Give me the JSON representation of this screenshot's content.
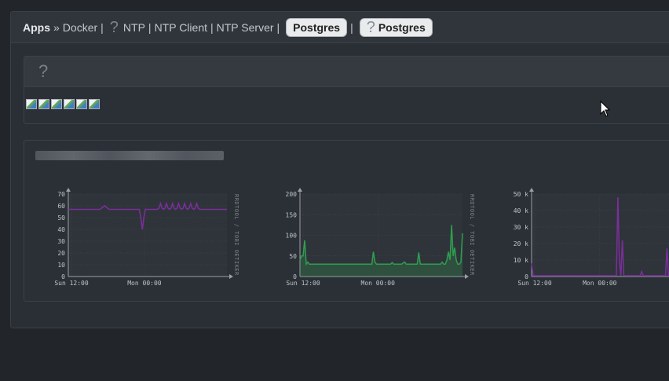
{
  "breadcrumb": {
    "apps": "Apps",
    "arrow": "»",
    "docker": "Docker",
    "pipe": "|",
    "ntp": "NTP",
    "ntp_client": "NTP Client",
    "ntp_server": "NTP Server",
    "postgres_1": "Postgres",
    "postgres_2": "Postgres",
    "unknown_icon": "?"
  },
  "panel_icons": {
    "header_icon": "?"
  },
  "thumbnail_count": 6,
  "colors": {
    "accent_purple": "#7b2f9c",
    "accent_green": "#2f9e4f"
  },
  "chart_data": [
    {
      "type": "line",
      "series": [
        {
          "values": [
            57,
            57,
            57,
            57,
            57,
            57,
            57,
            57,
            57,
            57,
            57,
            57,
            57,
            57,
            57,
            57,
            57,
            57,
            57,
            57,
            57,
            57,
            58,
            59,
            60,
            59,
            58,
            57,
            57,
            57,
            57,
            57,
            57,
            57,
            57,
            57,
            57,
            57,
            57,
            57,
            57,
            57,
            57,
            57,
            57,
            57,
            57,
            57,
            50,
            40,
            50,
            57,
            57,
            57,
            57,
            57,
            57,
            57,
            57,
            57,
            58,
            62,
            58,
            57,
            58,
            62,
            58,
            57,
            58,
            62,
            58,
            57,
            58,
            62,
            58,
            57,
            58,
            62,
            58,
            57,
            58,
            62,
            58,
            57,
            58,
            62,
            58,
            57,
            57,
            57,
            57,
            57,
            57,
            57,
            57,
            57,
            57,
            57,
            57,
            57,
            57,
            57,
            57,
            57,
            57,
            57
          ]
        }
      ],
      "x_ticks": [
        "Sun 12:00",
        "Mon 00:00"
      ],
      "y_ticks": [
        "0",
        "10",
        "20",
        "30",
        "40",
        "50",
        "60",
        "70"
      ],
      "ylim": [
        0,
        70
      ],
      "side_label": "RRDTOOL / TOBI OETIKER"
    },
    {
      "type": "line",
      "series": [
        {
          "values": [
            40,
            50,
            50,
            88,
            30,
            35,
            30,
            30,
            30,
            30,
            30,
            30,
            30,
            30,
            30,
            30,
            30,
            30,
            30,
            30,
            30,
            30,
            30,
            30,
            30,
            30,
            30,
            30,
            30,
            30,
            30,
            30,
            30,
            30,
            30,
            30,
            30,
            30,
            30,
            30,
            30,
            30,
            30,
            30,
            30,
            30,
            30,
            60,
            35,
            30,
            30,
            30,
            30,
            30,
            30,
            30,
            30,
            30,
            30,
            34,
            30,
            30,
            30,
            30,
            30,
            30,
            33,
            35,
            30,
            30,
            30,
            30,
            30,
            30,
            30,
            30,
            58,
            30,
            30,
            30,
            30,
            30,
            30,
            30,
            30,
            30,
            30,
            30,
            30,
            30,
            30,
            35,
            30,
            30,
            40,
            60,
            40,
            125,
            50,
            70,
            40,
            30,
            30,
            35,
            105
          ]
        }
      ],
      "x_ticks": [
        "Sun 12:00",
        "Mon 00:00"
      ],
      "y_ticks": [
        "0",
        "50",
        "100",
        "150",
        "200"
      ],
      "ylim": [
        0,
        200
      ],
      "side_label": "RRDTOOL / TOBI OETIKER"
    },
    {
      "type": "line",
      "series": [
        {
          "values": [
            8000,
            500,
            500,
            500,
            500,
            500,
            500,
            500,
            500,
            500,
            500,
            500,
            500,
            500,
            500,
            500,
            500,
            500,
            500,
            500,
            500,
            500,
            500,
            500,
            500,
            500,
            500,
            500,
            500,
            500,
            500,
            500,
            500,
            500,
            500,
            500,
            500,
            500,
            500,
            500,
            500,
            500,
            500,
            500,
            500,
            500,
            500,
            500,
            500,
            500,
            500,
            500,
            500,
            500,
            500,
            500,
            500,
            500,
            48000,
            10000,
            500,
            22000,
            500,
            500,
            500,
            500,
            500,
            500,
            500,
            500,
            500,
            500,
            500,
            500,
            3000,
            500,
            500,
            500,
            500,
            500,
            500,
            500,
            500,
            500,
            500,
            500,
            500,
            500,
            500,
            500,
            500,
            17000,
            500,
            500,
            500,
            500
          ]
        }
      ],
      "x_ticks": [
        "Sun 12:00",
        "Mon 00:00"
      ],
      "y_ticks": [
        "0",
        "10 k",
        "20 k",
        "30 k",
        "40 k",
        "50 k"
      ],
      "ylim": [
        0,
        50000
      ],
      "side_label": ""
    }
  ]
}
